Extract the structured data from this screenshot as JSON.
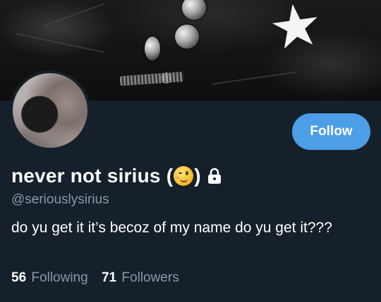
{
  "profile": {
    "display_name": "never not sirius (",
    "display_name_suffix": ")",
    "emoji": "winking-face",
    "handle": "@seriouslysirius",
    "bio": "do yu get it it’s becoz of my name do yu get it???",
    "protected": true
  },
  "actions": {
    "follow_label": "Follow"
  },
  "stats": {
    "following_count": "56",
    "following_label": "Following",
    "followers_count": "71",
    "followers_label": "Followers"
  },
  "colors": {
    "background": "#15202b",
    "accent": "#4c9ee6",
    "secondary_text": "#8899a6"
  },
  "icons": {
    "lock": "lock-icon",
    "emoji": "winking-face-icon"
  }
}
